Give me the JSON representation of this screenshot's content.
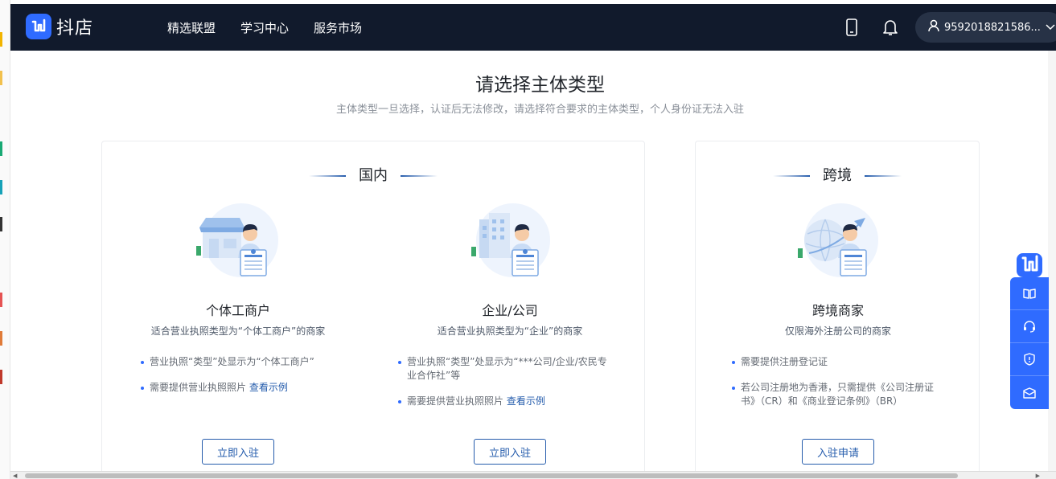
{
  "brand": {
    "name": "抖店",
    "color": "#2f6bff"
  },
  "nav": {
    "items": [
      "精选联盟",
      "学习中心",
      "服务市场"
    ]
  },
  "header": {
    "user_label": "9592018821586..."
  },
  "page": {
    "title": "请选择主体类型",
    "subtitle": "主体类型一旦选择，认证后无法修改，请选择符合要求的主体类型，个人身份证无法入驻"
  },
  "domestic": {
    "title": "国内",
    "individual": {
      "title": "个体工商户",
      "desc": "适合营业执照类型为“个体工商户”的商家",
      "req1": "营业执照“类型”处显示为“个体工商户”",
      "req2": "需要提供营业执照照片",
      "link": "查看示例",
      "button": "立即入驻"
    },
    "company": {
      "title": "企业/公司",
      "desc": "适合营业执照类型为“企业”的商家",
      "req1": "营业执照“类型”处显示为“***公司/企业/农民专业合作社”等",
      "req2": "需要提供营业执照照片",
      "link": "查看示例",
      "button": "立即入驻"
    }
  },
  "crossborder": {
    "title": "跨境",
    "merchant": {
      "title": "跨境商家",
      "desc": "仅限海外注册公司的商家",
      "req1": "需要提供注册登记证",
      "req2": "若公司注册地为香港，只需提供《公司注册证书》（CR）和《商业登记条例》（BR）",
      "button": "入驻申请"
    }
  },
  "colors": {
    "nav_bg": "#111a2c",
    "accent": "#2f6bff",
    "link": "#255cac"
  },
  "icons": [
    "phone-icon",
    "bell-icon",
    "user-icon",
    "chevron-down-icon",
    "book-icon",
    "headset-icon",
    "shield-icon",
    "mail-icon"
  ]
}
